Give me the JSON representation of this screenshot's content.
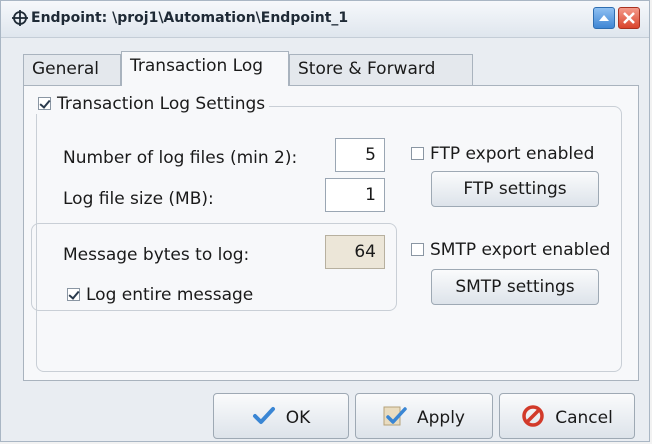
{
  "window": {
    "title": "Endpoint: \\proj1\\Automation\\Endpoint_1",
    "icon": "crosshair-icon"
  },
  "tabs": [
    {
      "label": "General",
      "active": false
    },
    {
      "label": "Transaction Log",
      "active": true
    },
    {
      "label": "Store & Forward",
      "active": false
    }
  ],
  "transaction_log": {
    "group_label": "Transaction Log Settings",
    "group_enabled": true,
    "num_files_label": "Number of log files (min 2):",
    "num_files_value": "5",
    "file_size_label": "Log file size (MB):",
    "file_size_value": "1",
    "message_bytes_label": "Message bytes to log:",
    "message_bytes_value": "64",
    "log_entire_label": "Log entire message",
    "log_entire_checked": true,
    "ftp_export_label": "FTP export enabled",
    "ftp_export_checked": false,
    "ftp_settings_label": "FTP settings",
    "smtp_export_label": "SMTP export enabled",
    "smtp_export_checked": false,
    "smtp_settings_label": "SMTP settings"
  },
  "footer": {
    "ok_label": "OK",
    "apply_label": "Apply",
    "cancel_label": "Cancel"
  },
  "colors": {
    "check_blue": "#3a86d4",
    "cancel_red": "#d23a2a"
  }
}
